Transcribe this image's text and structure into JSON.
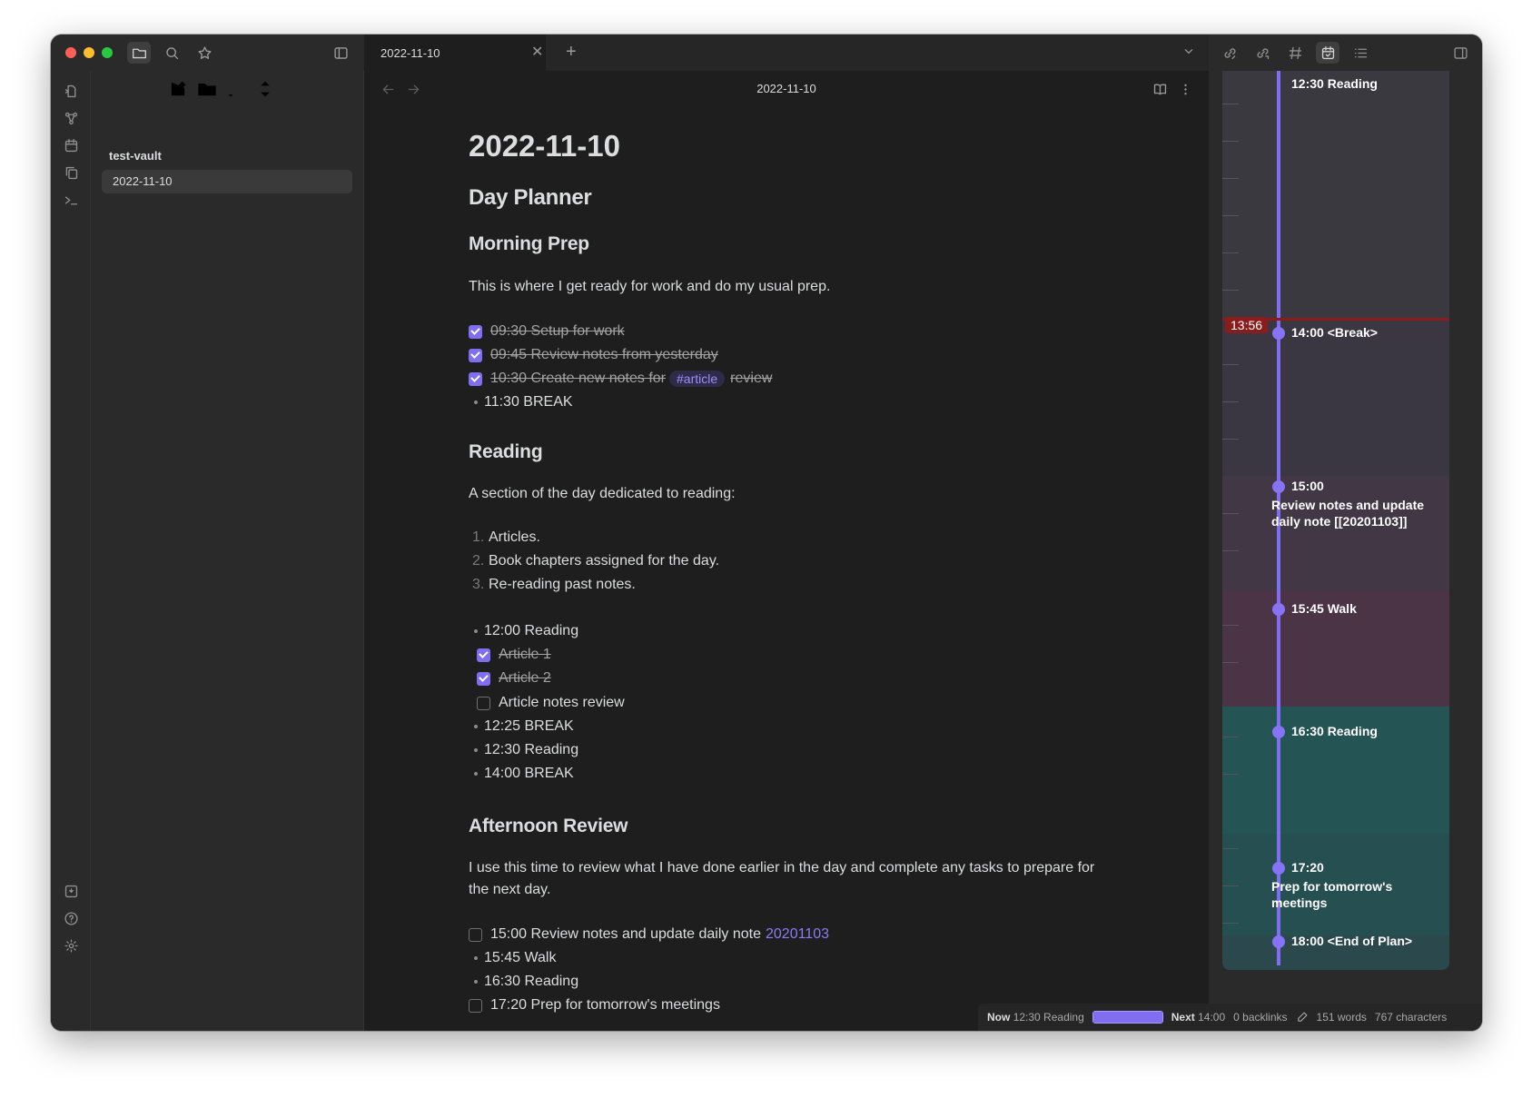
{
  "sidebar": {
    "vault_name": "test-vault",
    "files": [
      {
        "label": "2022-11-10"
      }
    ]
  },
  "tab": {
    "title": "2022-11-10"
  },
  "view": {
    "title": "2022-11-10"
  },
  "note": {
    "title": "2022-11-10",
    "h_day_planner": "Day Planner",
    "h_morning": "Morning Prep",
    "morning_para": "This is where I get ready for work and do my usual prep.",
    "morning_tasks": [
      {
        "text": "09:30 Setup for work"
      },
      {
        "text": "09:45 Review notes from yesterday"
      },
      {
        "pre": "10:30 Create new notes for",
        "tag": "#article",
        "post": "review"
      }
    ],
    "morning_break": "11:30 BREAK",
    "h_reading": "Reading",
    "reading_para": "A section of the day dedicated to reading:",
    "reading_list": [
      "Articles.",
      "Book chapters assigned for the day.",
      "Re-reading past notes."
    ],
    "reading_numbers": [
      "1.",
      "2.",
      "3."
    ],
    "reading_1200": "12:00 Reading",
    "reading_subtasks": [
      {
        "text": "Article 1",
        "done": true
      },
      {
        "text": "Article 2",
        "done": true
      },
      {
        "text": "Article notes review",
        "done": false
      }
    ],
    "reading_after": [
      "12:25 BREAK",
      "12:30 Reading",
      "14:00 BREAK"
    ],
    "h_afternoon": "Afternoon Review",
    "afternoon_para": "I use this time to review what I have done earlier in the day and complete any tasks to prepare for the next day.",
    "afternoon_task1_text": "15:00 Review notes and update daily note",
    "afternoon_task1_link": "20201103",
    "afternoon_items": [
      "15:45 Walk",
      "16:30 Reading"
    ],
    "afternoon_task_last": "17:20 Prep for tomorrow's meetings"
  },
  "timeline": {
    "now_time": "13:56",
    "entries": [
      {
        "label": "12:30 Reading"
      },
      {
        "label": "14:00 <Break>"
      },
      {
        "label": "15:00",
        "sub": "Review notes and update daily note [[20201103]]"
      },
      {
        "label": "15:45 Walk"
      },
      {
        "label": "16:30 Reading"
      },
      {
        "label": "17:20",
        "sub": "Prep for tomorrow's meetings"
      },
      {
        "label": "18:00 <End of Plan>"
      }
    ],
    "colors": {
      "reading": "#39393f",
      "break": "#3a3743",
      "review": "#413745",
      "walk": "#4a3446",
      "reading2": "#245554",
      "prep": "#264f52",
      "axis": "#7f6df2",
      "now": "#8b1c1c"
    }
  },
  "statusbar": {
    "now_label": "Now",
    "now_value": "12:30 Reading",
    "progress_fraction": 1.0,
    "next_label": "Next",
    "next_value": "14:00",
    "backlinks": "0 backlinks",
    "words": "151 words",
    "characters": "767 characters"
  },
  "colors": {
    "accent": "#7f6df2",
    "background": "#1e1e1e",
    "sidebar": "#2a2a2a"
  }
}
